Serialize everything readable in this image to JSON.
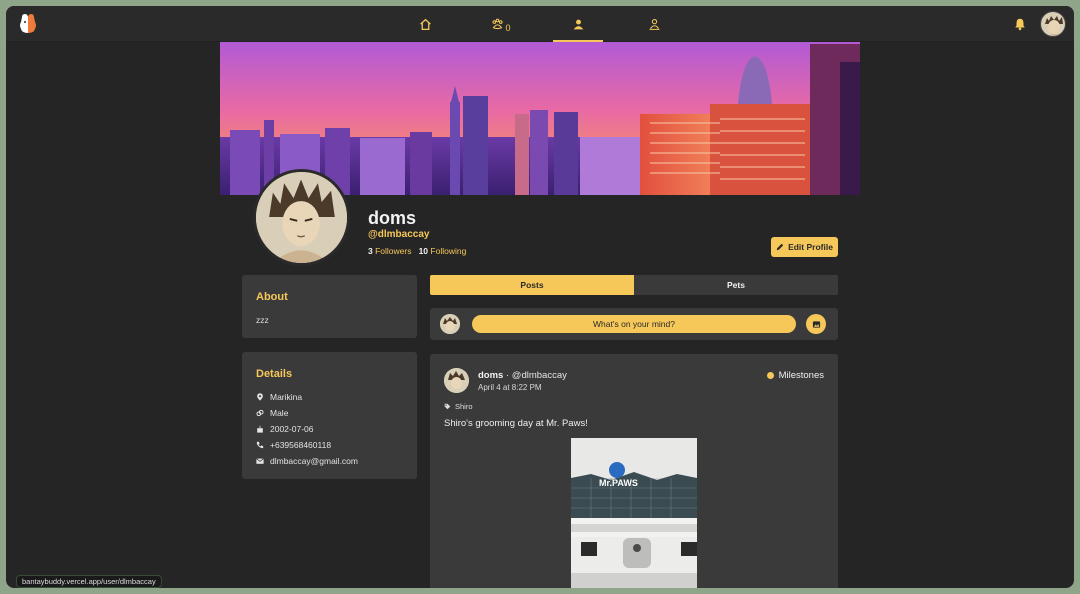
{
  "nav": {
    "logo_icon": "bantaybuddy-logo",
    "tabs": [
      {
        "icon": "home-icon"
      },
      {
        "icon": "pets-icon",
        "count": "0"
      },
      {
        "icon": "profile-icon",
        "active": true
      },
      {
        "icon": "pet-owner-icon"
      }
    ],
    "notifications_icon": "bell-icon"
  },
  "profile": {
    "name": "doms",
    "handle": "@dlmbaccay",
    "followers_count": "3",
    "followers_label": "Followers",
    "following_count": "10",
    "following_label": "Following",
    "edit_label": "Edit Profile"
  },
  "about": {
    "title": "About",
    "text": "zzz"
  },
  "details": {
    "title": "Details",
    "location": "Marikina",
    "gender": "Male",
    "birthday": "2002-07-06",
    "phone": "+639568460118",
    "email": "dlmbaccay@gmail.com"
  },
  "tabs": {
    "posts": "Posts",
    "pets": "Pets"
  },
  "composer": {
    "placeholder": "What's on your mind?",
    "photo_icon": "image-icon"
  },
  "post": {
    "author": "doms",
    "handle": "@dlmbaccay",
    "separator": "·",
    "time": "April 4 at 8:22 PM",
    "category": "Milestones",
    "pet_tag": "Shiro",
    "text": "Shiro's grooming day at Mr. Paws!",
    "image_sign": "Mr.PAWS"
  },
  "status_url": "bantaybuddy.vercel.app/user/dlmbaccay",
  "colors": {
    "accent": "#f6c85a",
    "background": "#252525",
    "card": "#3a3a3a"
  }
}
